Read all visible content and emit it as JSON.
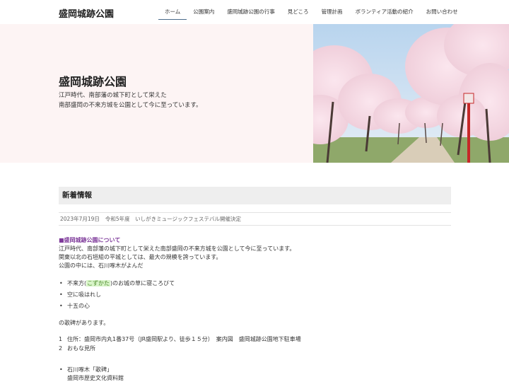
{
  "header": {
    "site_title": "盛岡城跡公園",
    "nav": [
      "ホーム",
      "公園案内",
      "盛岡城跡公園の行事",
      "見どころ",
      "管理計画",
      "ボランティア活動の紹介",
      "お問い合わせ"
    ]
  },
  "hero": {
    "title": "盛岡城跡公園",
    "subtitle_lines": [
      "江戸時代、南部藩の城下町として栄えた",
      "南部盛岡の不来方城を公園として今に至っています。"
    ]
  },
  "news": {
    "heading": "新着情報",
    "items": [
      {
        "date": "2023年7月19日",
        "title": "令和5年度　いしがきミュージックフェステバル開催決定"
      }
    ]
  },
  "about": {
    "heading": "■盛岡城跡公園について",
    "lines": [
      "江戸時代、南部藩の城下町として栄えた南部盛岡の不来方城を公園として今に至っています。",
      "関東以北の石垣組の平城としては、最大の規模を誇っています。",
      "公園の中には、石川啄木がよんだ"
    ],
    "songs": {
      "first_pre": "不来方(",
      "first_highlight": "こずかた",
      "first_post": ")のお城の草に寝ころびて",
      "rest": [
        "空に吸はれし",
        "十五の心"
      ]
    },
    "after_songs": "の歌碑があります。",
    "address": [
      {
        "num": "1",
        "text": "住所：盛岡市内丸1番37号（JR盛岡駅より、徒歩１５分）　案内図　盛岡城跡公園地下駐車場"
      },
      {
        "num": "2",
        "text": "おもな見所"
      }
    ],
    "spots": [
      "石川啄木「歌碑」",
      "盛岡市歴史文化資料館"
    ]
  },
  "colors": {
    "hero_bg": "#fdf4f4",
    "accent_purple": "#7e3a9a",
    "highlight_bg": "#d8f4c8"
  }
}
